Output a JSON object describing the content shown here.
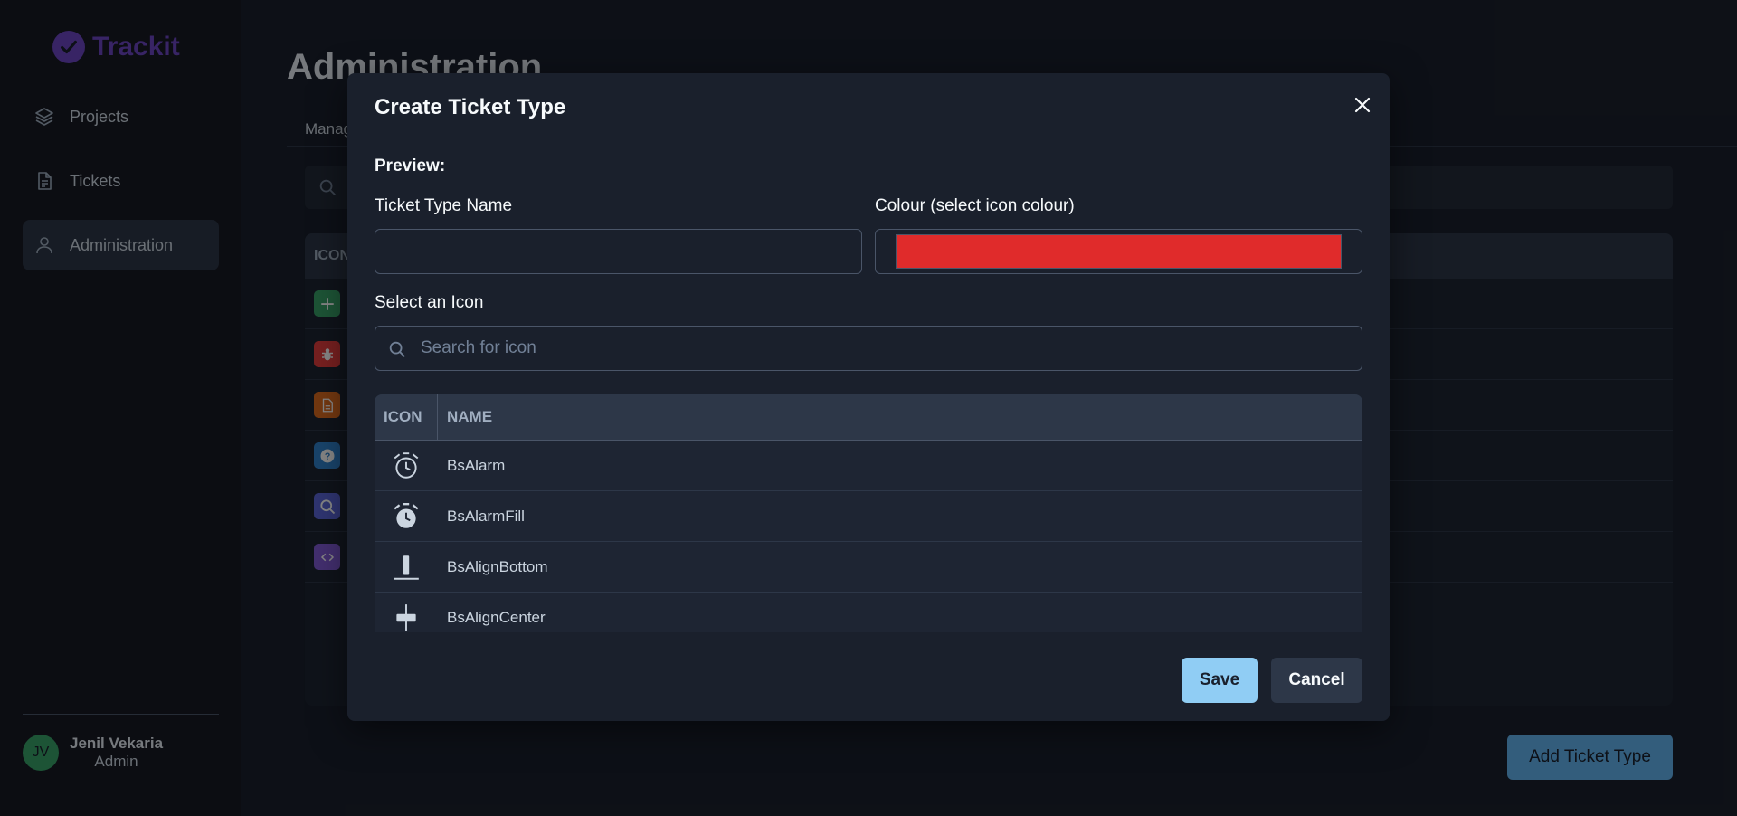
{
  "app": {
    "name": "Trackit",
    "brand_color": "#6b46c1"
  },
  "sidebar": {
    "items": [
      {
        "label": "Projects",
        "icon": "layers-icon",
        "active": false
      },
      {
        "label": "Tickets",
        "icon": "document-icon",
        "active": false
      },
      {
        "label": "Administration",
        "icon": "user-icon",
        "active": true
      }
    ],
    "user": {
      "initials": "JV",
      "name": "Jenil Vekaria",
      "role": "Admin"
    }
  },
  "main": {
    "title": "Administration",
    "tab_label": "Manag",
    "table_header": "ICON",
    "ticket_types": [
      {
        "icon": "plus-icon",
        "color": "#38a169"
      },
      {
        "icon": "bug-icon",
        "color": "#e53e3e"
      },
      {
        "icon": "document-icon",
        "color": "#dd6b20"
      },
      {
        "icon": "question-icon",
        "color": "#3182ce"
      },
      {
        "icon": "search-icon",
        "color": "#5a67d8"
      },
      {
        "icon": "code-icon",
        "color": "#805ad5"
      }
    ],
    "add_button": "Add Ticket Type"
  },
  "modal": {
    "title": "Create Ticket Type",
    "preview_label": "Preview:",
    "name_label": "Ticket Type Name",
    "name_value": "",
    "colour_label": "Colour (select icon colour)",
    "colour_value": "#e02b2b",
    "icon_label": "Select an Icon",
    "search_placeholder": "Search for icon",
    "table": {
      "col_icon": "ICON",
      "col_name": "NAME",
      "rows": [
        {
          "icon": "alarm-icon",
          "name": "BsAlarm"
        },
        {
          "icon": "alarm-fill-icon",
          "name": "BsAlarmFill"
        },
        {
          "icon": "align-bottom-icon",
          "name": "BsAlignBottom"
        },
        {
          "icon": "align-center-icon",
          "name": "BsAlignCenter"
        }
      ]
    },
    "save_label": "Save",
    "cancel_label": "Cancel"
  }
}
